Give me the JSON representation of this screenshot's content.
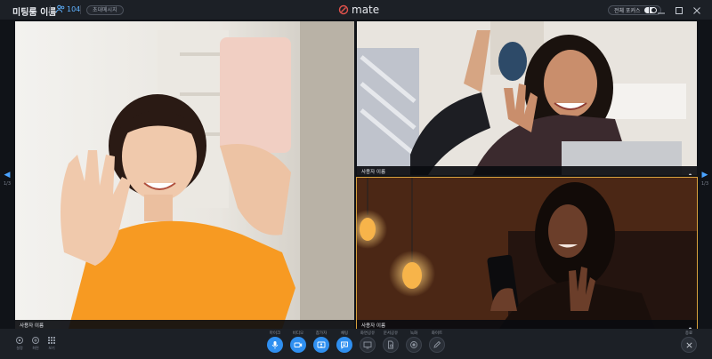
{
  "header": {
    "room_title": "미팅룸 이름",
    "participant_count": "104",
    "invite_label": "초대메시지",
    "brand_name": "mate",
    "focus_mode_label": "전체 포커스"
  },
  "navigation": {
    "left_page": "1/3",
    "right_page": "1/3"
  },
  "tiles": [
    {
      "label": "사용자 이름"
    },
    {
      "label": "사용자 이름"
    },
    {
      "label": "사용자 이름"
    }
  ],
  "toolbar": {
    "left": [
      {
        "label": "설정",
        "icon": "gear-icon"
      },
      {
        "label": "화면",
        "icon": "focus-icon"
      },
      {
        "label": "보기",
        "icon": "grid-icon"
      }
    ],
    "center": [
      {
        "label": "마이크",
        "icon": "mic-icon",
        "active": true
      },
      {
        "label": "비디오",
        "icon": "video-icon",
        "active": true
      },
      {
        "label": "참가자",
        "icon": "participants-icon",
        "active": true
      },
      {
        "label": "채팅",
        "icon": "chat-icon",
        "active": true
      },
      {
        "label": "화면공유",
        "icon": "screen-share-icon",
        "active": false
      },
      {
        "label": "문서공유",
        "icon": "document-icon",
        "active": false
      },
      {
        "label": "녹화",
        "icon": "record-icon",
        "active": false
      },
      {
        "label": "화이트",
        "icon": "pen-icon",
        "active": false
      }
    ],
    "end_label": "종료"
  },
  "colors": {
    "accent": "#2f8ff0",
    "background": "#15181d",
    "bar": "#1c2026"
  }
}
